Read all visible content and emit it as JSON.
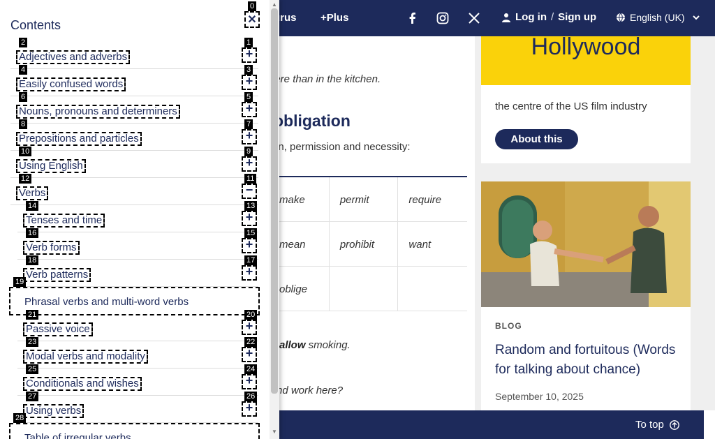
{
  "nav": {
    "thesaurus": "urus",
    "plus": "+Plus",
    "login": "Log in",
    "slash": "/",
    "signup": "Sign up",
    "language": "English (UK)"
  },
  "article": {
    "example_top": "here than in the kitchen.",
    "heading": "obligation",
    "intro": "on, permission and necessity:",
    "table": [
      [
        "make",
        "permit",
        "require"
      ],
      [
        "mean",
        "prohibit",
        "want"
      ],
      [
        "oblige",
        "",
        ""
      ]
    ],
    "example2_bold": "allow",
    "example2_rest": " smoking.",
    "example3": "nd work here?"
  },
  "rail": {
    "word": "Hollywood",
    "definition": "the centre of the US film industry",
    "about_label": "About this",
    "blog_tag": "BLOG",
    "blog_title": "Random and fortuitous (Words for talking about chance)",
    "blog_date": "September 10, 2025"
  },
  "bottom": {
    "to_top": "To top"
  },
  "contents": {
    "title": "Contents",
    "close_badge": "0",
    "items": [
      {
        "label": "Adjectives and adverbs",
        "label_badge": "2",
        "btn_badge": "1",
        "btn": "+"
      },
      {
        "label": "Easily confused words",
        "label_badge": "4",
        "btn_badge": "3",
        "btn": "+"
      },
      {
        "label": "Nouns, pronouns and determiners",
        "label_badge": "6",
        "btn_badge": "5",
        "btn": "+"
      },
      {
        "label": "Prepositions and particles",
        "label_badge": "8",
        "btn_badge": "7",
        "btn": "+"
      },
      {
        "label": "Using English",
        "label_badge": "10",
        "btn_badge": "9",
        "btn": "+"
      },
      {
        "label": "Verbs",
        "label_badge": "12",
        "btn_badge": "11",
        "btn": "−"
      }
    ],
    "subitems": [
      {
        "label": "Tenses and time",
        "label_badge": "14",
        "btn_badge": "13",
        "btn": "+"
      },
      {
        "label": "Verb forms",
        "label_badge": "16",
        "btn_badge": "15",
        "btn": "+"
      },
      {
        "label": "Verb patterns",
        "label_badge": "18",
        "btn_badge": "17",
        "btn": "+"
      }
    ],
    "phrasal": {
      "label": "Phrasal verbs and multi-word verbs",
      "badge": "19"
    },
    "subitems2": [
      {
        "label": "Passive voice",
        "label_badge": "21",
        "btn_badge": "20",
        "btn": "+"
      },
      {
        "label": "Modal verbs and modality",
        "label_badge": "23",
        "btn_badge": "22",
        "btn": "+"
      },
      {
        "label": "Conditionals and wishes",
        "label_badge": "25",
        "btn_badge": "24",
        "btn": "+"
      },
      {
        "label": "Using verbs",
        "label_badge": "27",
        "btn_badge": "26",
        "btn": "+"
      }
    ],
    "irregular": {
      "label": "Table of irregular verbs",
      "badge": "28"
    }
  }
}
